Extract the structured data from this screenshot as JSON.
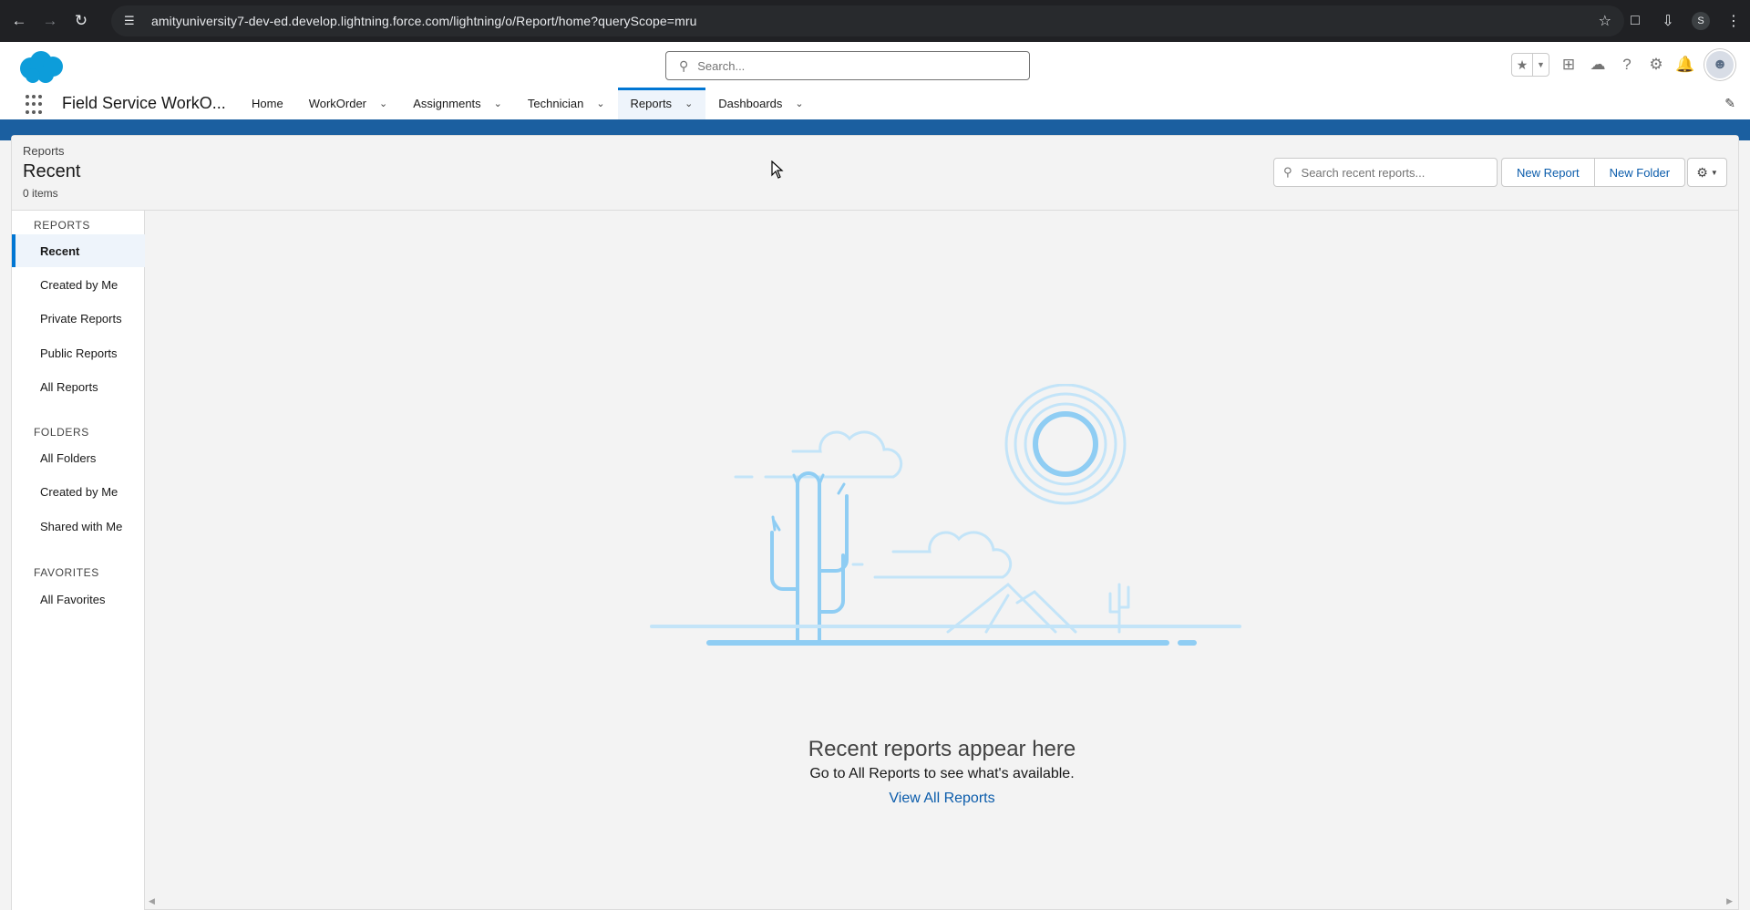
{
  "browser": {
    "url": "amityuniversity7-dev-ed.develop.lightning.force.com/lightning/o/Report/home?queryScope=mru",
    "profile_initial": "S"
  },
  "header": {
    "search_placeholder": "Search..."
  },
  "nav": {
    "app_name": "Field Service WorkO...",
    "items": [
      {
        "label": "Home",
        "has_menu": false
      },
      {
        "label": "WorkOrder",
        "has_menu": true
      },
      {
        "label": "Assignments",
        "has_menu": true
      },
      {
        "label": "Technician",
        "has_menu": true
      },
      {
        "label": "Reports",
        "has_menu": true,
        "active": true
      },
      {
        "label": "Dashboards",
        "has_menu": true
      }
    ]
  },
  "page": {
    "breadcrumb": "Reports",
    "title": "Recent",
    "count": "0 items",
    "search_placeholder": "Search recent reports...",
    "new_report_label": "New Report",
    "new_folder_label": "New Folder"
  },
  "sidebar": {
    "sections": [
      {
        "title": "REPORTS",
        "items": [
          "Recent",
          "Created by Me",
          "Private Reports",
          "Public Reports",
          "All Reports"
        ]
      },
      {
        "title": "FOLDERS",
        "items": [
          "All Folders",
          "Created by Me",
          "Shared with Me"
        ]
      },
      {
        "title": "FAVORITES",
        "items": [
          "All Favorites"
        ]
      }
    ],
    "active_item": "Recent"
  },
  "empty_state": {
    "title": "Recent reports appear here",
    "subtitle": "Go to All Reports to see what's available.",
    "link": "View All Reports"
  },
  "colors": {
    "brand_blue": "#0176d3",
    "link_blue": "#0b5cab",
    "band_blue": "#1b5fa0",
    "illustration_blue": "#8fcdf3"
  }
}
